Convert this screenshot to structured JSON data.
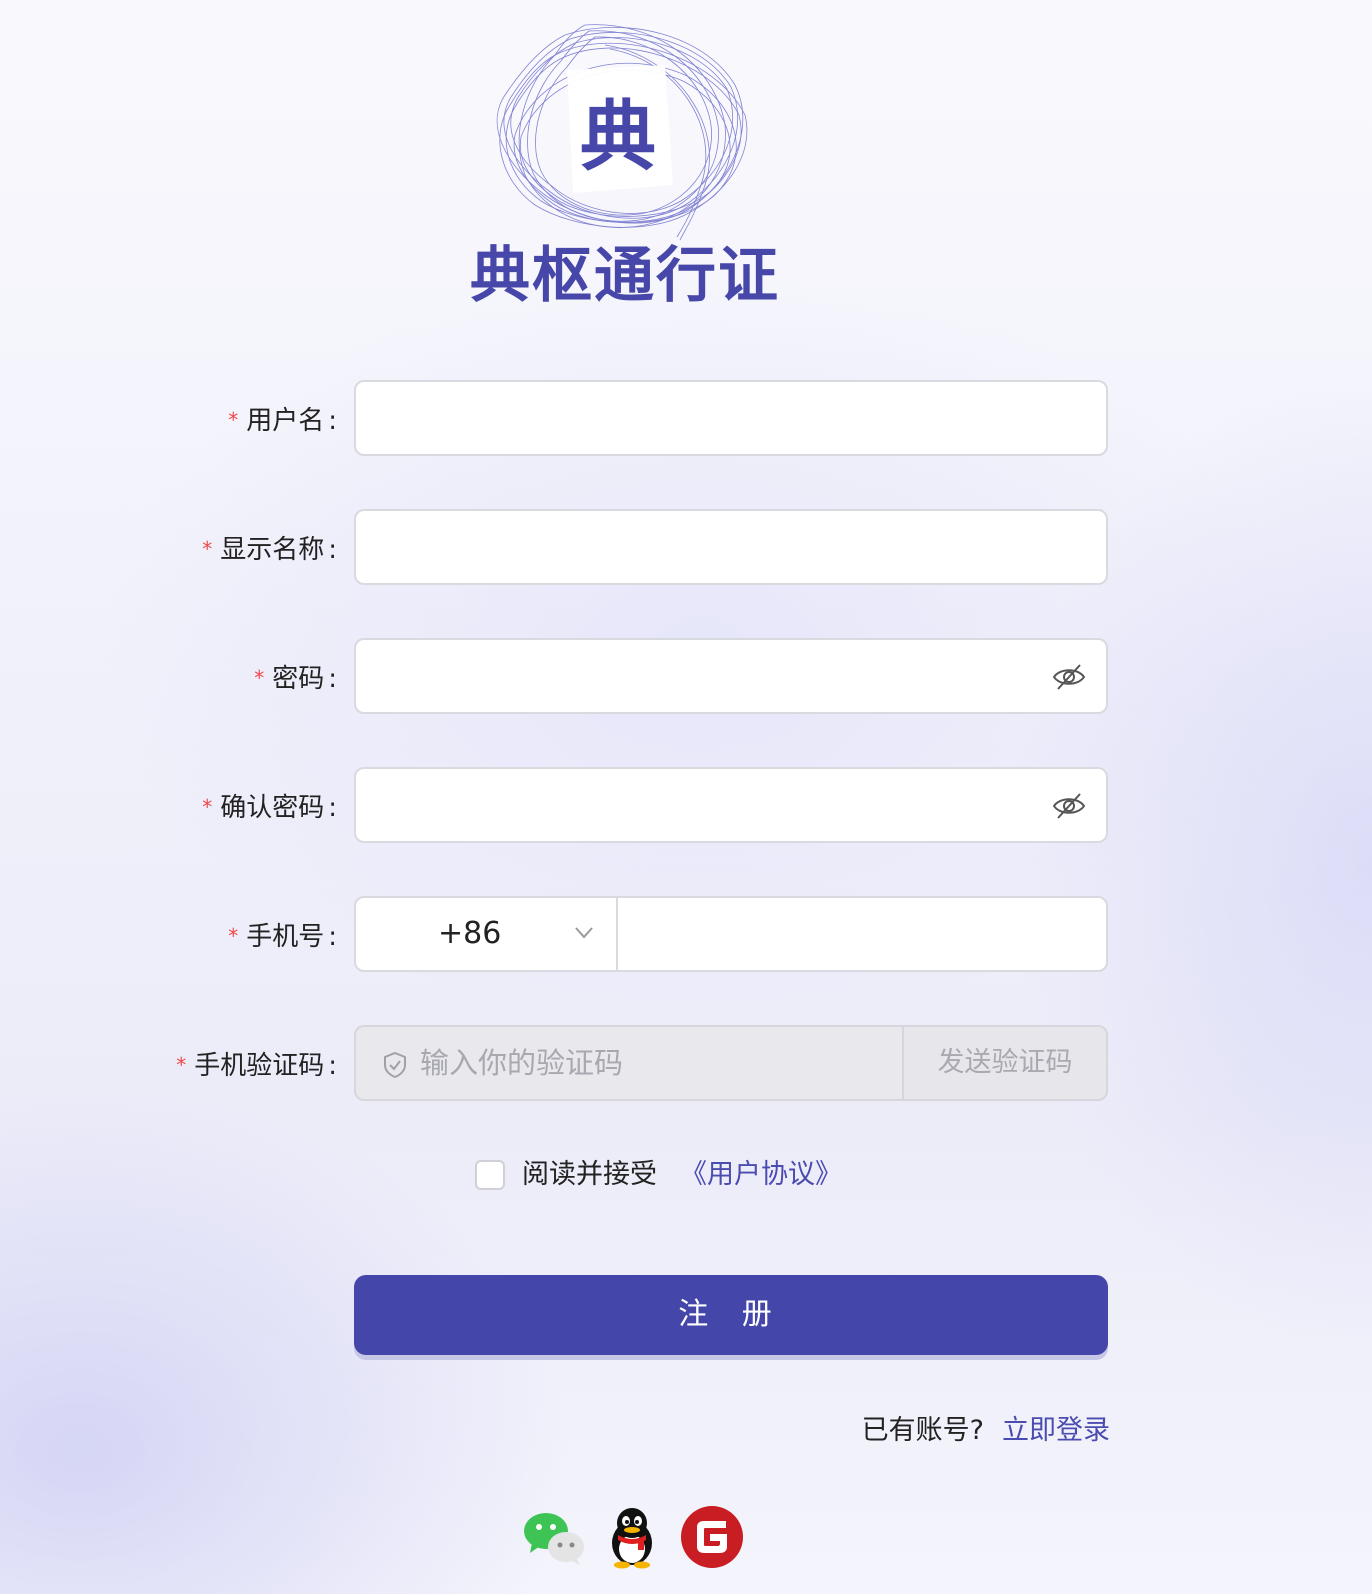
{
  "brand": {
    "title": "典枢通行证",
    "logo_char": "典"
  },
  "form": {
    "username": {
      "label": "用户名",
      "value": ""
    },
    "display_name": {
      "label": "显示名称",
      "value": ""
    },
    "password": {
      "label": "密码",
      "value": ""
    },
    "confirm_password": {
      "label": "确认密码",
      "value": ""
    },
    "phone": {
      "label": "手机号",
      "country_code": "+86",
      "value": ""
    },
    "sms_code": {
      "label": "手机验证码",
      "placeholder": "输入你的验证码",
      "send_label": "发送验证码"
    },
    "required_mark": "*",
    "colon": ":"
  },
  "agreement": {
    "text": "阅读并接受",
    "link": "《用户协议》",
    "checked": false
  },
  "submit_label": "注 册",
  "login": {
    "question": "已有账号?",
    "link": "立即登录"
  },
  "social": [
    {
      "name": "wechat",
      "icon": "wechat-icon",
      "color": "#3dc455"
    },
    {
      "name": "qq",
      "icon": "qq-icon",
      "color": "#111111"
    },
    {
      "name": "gitee",
      "icon": "gitee-icon",
      "color": "#c71d23"
    }
  ],
  "colors": {
    "accent": "#4447a9",
    "required": "#f04848",
    "link": "#4a4cb0"
  }
}
